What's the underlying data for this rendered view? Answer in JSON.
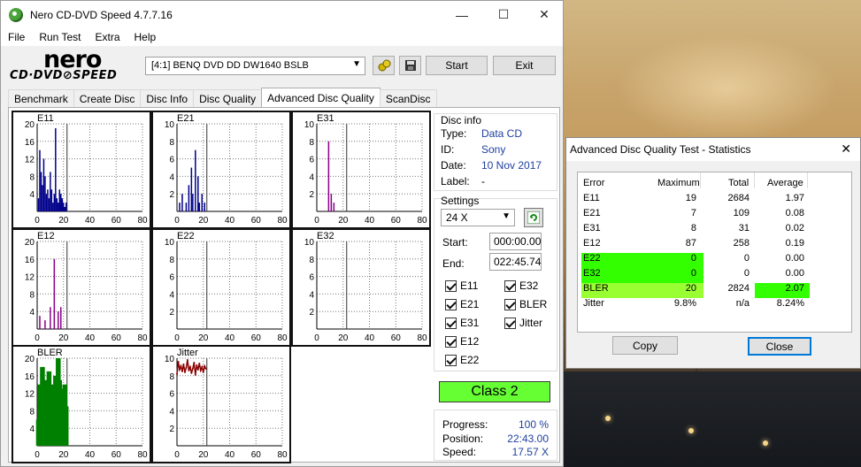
{
  "window": {
    "title": "Nero CD-DVD Speed 4.7.7.16",
    "minimize": "—",
    "maximize": "☐",
    "close": "✕"
  },
  "menu": [
    "File",
    "Run Test",
    "Extra",
    "Help"
  ],
  "logo": {
    "line1": "nero",
    "line2": "CD·DVD⊘SPEED"
  },
  "toolbar": {
    "drive": "[4:1]   BENQ DVD DD DW1640 BSLB",
    "start_label": "Start",
    "exit_label": "Exit"
  },
  "tabs": [
    "Benchmark",
    "Create Disc",
    "Disc Info",
    "Disc Quality",
    "Advanced Disc Quality",
    "ScanDisc"
  ],
  "active_tab": "Advanced Disc Quality",
  "disc_info": {
    "heading": "Disc info",
    "type_label": "Type:",
    "type_value": "Data CD",
    "id_label": "ID:",
    "id_value": "Sony",
    "date_label": "Date:",
    "date_value": "10 Nov 2017",
    "label_label": "Label:",
    "label_value": "-"
  },
  "settings": {
    "heading": "Settings",
    "speed": "24 X",
    "start_label": "Start:",
    "start_value": "000:00.00",
    "end_label": "End:",
    "end_value": "022:45.74",
    "checks": [
      {
        "label": "E11",
        "checked": true
      },
      {
        "label": "E32",
        "checked": true
      },
      {
        "label": "E21",
        "checked": true
      },
      {
        "label": "BLER",
        "checked": true
      },
      {
        "label": "E31",
        "checked": true
      },
      {
        "label": "Jitter",
        "checked": true
      },
      {
        "label": "E12",
        "checked": true
      },
      {
        "label": "E22",
        "checked": true
      }
    ]
  },
  "class_result": "Class 2",
  "progress": {
    "progress_label": "Progress:",
    "progress_value": "100 %",
    "position_label": "Position:",
    "position_value": "22:43.00",
    "speed_label": "Speed:",
    "speed_value": "17.57 X"
  },
  "chart_data": [
    {
      "type": "bar",
      "title": "E11",
      "ylim": [
        0,
        20
      ],
      "yticks": [
        "20",
        "16",
        "12",
        "8",
        "4"
      ],
      "xticks": [
        "0",
        "20",
        "40",
        "60",
        "80"
      ],
      "color": "#00008b",
      "x": [
        1,
        2,
        3,
        4,
        5,
        6,
        7,
        8,
        9,
        10,
        11,
        12,
        13,
        14,
        15,
        16,
        17,
        18,
        19,
        20,
        21,
        22
      ],
      "values": [
        3,
        14,
        9,
        6,
        12,
        8,
        4,
        5,
        3,
        9,
        5,
        2,
        4,
        19,
        3,
        2,
        5,
        4,
        3,
        2,
        1,
        2
      ]
    },
    {
      "type": "bar",
      "title": "E21",
      "ylim": [
        0,
        10
      ],
      "yticks": [
        "10",
        "8",
        "6",
        "4",
        "2"
      ],
      "xticks": [
        "0",
        "20",
        "40",
        "60",
        "80"
      ],
      "color": "#00008b",
      "x": [
        2,
        4,
        7,
        9,
        11,
        12,
        14,
        16,
        17,
        19,
        21
      ],
      "values": [
        1,
        2,
        1,
        3,
        5,
        2,
        7,
        4,
        1,
        2,
        1
      ]
    },
    {
      "type": "bar",
      "title": "E31",
      "ylim": [
        0,
        10
      ],
      "yticks": [
        "10",
        "8",
        "6",
        "4",
        "2"
      ],
      "xticks": [
        "0",
        "20",
        "40",
        "60",
        "80"
      ],
      "color": "#8b008b",
      "x": [
        9,
        11,
        13
      ],
      "values": [
        8,
        2,
        1
      ]
    },
    {
      "type": "bar",
      "title": "E12",
      "ylim": [
        0,
        20
      ],
      "yticks": [
        "20",
        "16",
        "12",
        "8",
        "4"
      ],
      "xticks": [
        "0",
        "20",
        "40",
        "60",
        "80"
      ],
      "color": "#8b008b",
      "x": [
        2,
        6,
        10,
        13,
        16,
        18
      ],
      "values": [
        3,
        2,
        5,
        16,
        4,
        5
      ]
    },
    {
      "type": "bar",
      "title": "E22",
      "ylim": [
        0,
        10
      ],
      "yticks": [
        "10",
        "8",
        "6",
        "4",
        "2"
      ],
      "xticks": [
        "0",
        "20",
        "40",
        "60",
        "80"
      ],
      "color": "#00008b",
      "x": [],
      "values": []
    },
    {
      "type": "bar",
      "title": "E32",
      "ylim": [
        0,
        10
      ],
      "yticks": [
        "10",
        "8",
        "6",
        "4",
        "2"
      ],
      "xticks": [
        "0",
        "20",
        "40",
        "60",
        "80"
      ],
      "color": "#00008b",
      "x": [],
      "values": []
    },
    {
      "type": "bar",
      "title": "BLER",
      "ylim": [
        0,
        20
      ],
      "yticks": [
        "20",
        "16",
        "12",
        "8",
        "4"
      ],
      "xticks": [
        "0",
        "20",
        "40",
        "60",
        "80"
      ],
      "color": "#008000",
      "x": [
        1,
        2,
        3,
        4,
        5,
        6,
        7,
        8,
        9,
        10,
        11,
        12,
        13,
        14,
        15,
        16,
        17,
        18,
        19,
        20,
        21,
        22
      ],
      "values": [
        6,
        14,
        10,
        18,
        13,
        12,
        15,
        9,
        17,
        11,
        14,
        10,
        13,
        16,
        12,
        20,
        15,
        11,
        13,
        10,
        14,
        9
      ]
    },
    {
      "type": "line",
      "title": "Jitter",
      "ylim": [
        0,
        10
      ],
      "yticks": [
        "10",
        "8",
        "6",
        "4",
        "2"
      ],
      "xticks": [
        "0",
        "20",
        "40",
        "60",
        "80"
      ],
      "color": "#8b0000",
      "x": [
        0,
        1,
        2,
        3,
        4,
        5,
        6,
        7,
        8,
        9,
        10,
        11,
        12,
        13,
        14,
        15,
        16,
        17,
        18,
        19,
        20,
        21,
        22
      ],
      "values": [
        8.2,
        9.6,
        8.7,
        9.1,
        8.5,
        9.3,
        8.4,
        8.9,
        9.8,
        8.6,
        9.0,
        8.3,
        8.8,
        9.5,
        8.1,
        9.2,
        8.7,
        9.4,
        8.6,
        9.0,
        8.4,
        9.1,
        8.8
      ]
    }
  ],
  "stats_dialog": {
    "title": "Advanced Disc Quality Test - Statistics",
    "close": "✕",
    "headers": [
      "Error",
      "Maximum",
      "Total",
      "Average"
    ],
    "rows": [
      [
        "E11",
        "19",
        "2684",
        "1.97"
      ],
      [
        "E21",
        "7",
        "109",
        "0.08"
      ],
      [
        "E31",
        "8",
        "31",
        "0.02"
      ],
      [
        "E12",
        "87",
        "258",
        "0.19"
      ],
      [
        "E22",
        "0",
        "0",
        "0.00"
      ],
      [
        "E32",
        "0",
        "0",
        "0.00"
      ],
      [
        "BLER",
        "20",
        "2824",
        "2.07"
      ],
      [
        "Jitter",
        "9.8%",
        "n/a",
        "8.24%"
      ]
    ],
    "copy_label": "Copy",
    "close_label": "Close",
    "highlight_bright": "#33ff00",
    "highlight_lime": "#99ff33"
  }
}
